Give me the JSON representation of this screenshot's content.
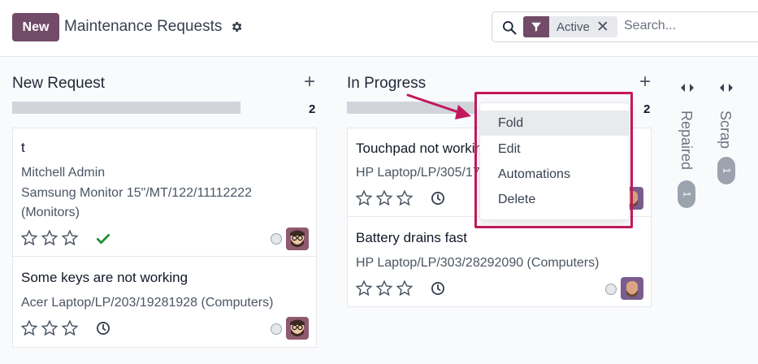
{
  "control_panel": {
    "new_button": "New",
    "title": "Maintenance Requests",
    "search": {
      "facet_label": "Active",
      "facet_remove": "✕",
      "placeholder": "Search..."
    }
  },
  "columns": [
    {
      "title": "New Request",
      "count": "2",
      "progress": 1.0,
      "cards": [
        {
          "title": "t",
          "lines": [
            "Mitchell Admin",
            "Samsung Monitor 15\"/MT/122/11112222",
            "(Monitors)"
          ],
          "activity": "check",
          "avatar": "bearded-man-glasses"
        },
        {
          "title": "Some keys are not working",
          "lines": [
            "Acer Laptop/LP/203/19281928 (Computers)"
          ],
          "activity": "clock",
          "avatar": "bearded-man-glasses"
        }
      ]
    },
    {
      "title": "In Progress",
      "count": "2",
      "progress": 1.0,
      "cards": [
        {
          "title": "Touchpad not working",
          "lines": [
            "HP Laptop/LP/305/17281718 (Computers)"
          ],
          "activity": "clock",
          "avatar": "bearded-man"
        },
        {
          "title": "Battery drains fast",
          "lines": [
            "HP Laptop/LP/303/28292090 (Computers)"
          ],
          "activity": "clock",
          "avatar": "bearded-man"
        }
      ]
    }
  ],
  "folded_columns": [
    {
      "title": "Repaired",
      "count": "1"
    },
    {
      "title": "Scrap",
      "count": "1"
    }
  ],
  "dropdown": {
    "items": [
      "Fold",
      "Edit",
      "Automations",
      "Delete"
    ],
    "active": "Fold"
  },
  "colors": {
    "brand": "#714b67",
    "check": "#1f8f3a",
    "highlight": "#c2185b"
  },
  "icons": {
    "settings": "gear-icon",
    "search": "search-icon",
    "filter": "filter-icon",
    "add": "plus-icon",
    "fold": "fold-arrows-icon"
  }
}
